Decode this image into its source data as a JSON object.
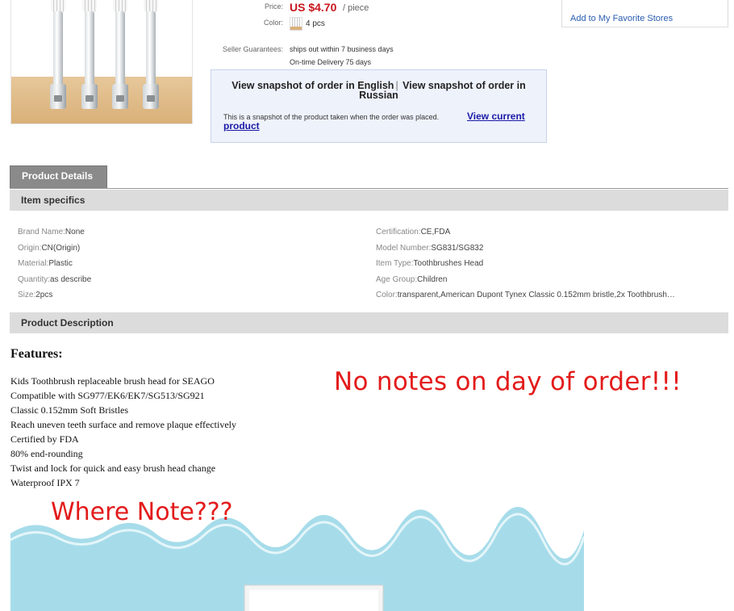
{
  "product": {
    "price_label": "Price:",
    "price_value": "US $4.70",
    "price_unit": "/ piece",
    "color_label": "Color:",
    "color_value": "4 pcs",
    "seller_label": "Seller Guarantees:",
    "guarantees": [
      "ships out within 7 business days",
      "On-time Delivery 75 days"
    ]
  },
  "store": {
    "favorite_link": "Add to My Favorite Stores"
  },
  "snapshot": {
    "english_link": "View snapshot of order in English",
    "separator": "|",
    "russian_link": "View snapshot of order in Russian",
    "note": "This is a snapshot of the product taken when the order was placed.",
    "current_link": "View current product"
  },
  "tabs": {
    "product_details": "Product Details"
  },
  "sections": {
    "item_specifics": "Item specifics",
    "product_description": "Product Description"
  },
  "specifics": {
    "left": [
      {
        "label": "Brand Name:",
        "value": "None"
      },
      {
        "label": "Origin:",
        "value": "CN(Origin)"
      },
      {
        "label": "Material:",
        "value": "Plastic"
      },
      {
        "label": "Quantity:",
        "value": "as describe"
      },
      {
        "label": "Size:",
        "value": "2pcs"
      }
    ],
    "right": [
      {
        "label": "Certification:",
        "value": "CE,FDA"
      },
      {
        "label": "Model Number:",
        "value": "SG831/SG832"
      },
      {
        "label": "Item Type:",
        "value": "Toothbrushes Head"
      },
      {
        "label": "Age Group:",
        "value": "Children"
      },
      {
        "label": "Color:",
        "value": "transparent,American Dupont Tynex Classic 0.152mm bristle,2x Toothbrush…"
      }
    ]
  },
  "description": {
    "features_title": "Features:",
    "features": [
      "Kids Toothbrush replaceable brush head for SEAGO",
      "Compatible with SG977/EK6/EK7/SG513/SG921",
      "Classic 0.152mm Soft Bristles",
      "Reach uneven teeth surface and remove plaque effectively",
      "Certified by FDA",
      "80% end-rounding",
      "Twist and lock for quick and easy brush head change",
      "Waterproof IPX 7"
    ]
  },
  "annotations": {
    "no_notes": "No notes on day of order!!!",
    "where_note": "Where Note???"
  },
  "colors": {
    "price_red": "#c8161d",
    "annotation_red": "#e31b1b",
    "link_blue": "#1a1aa6",
    "banner_blue": "#a6dcea"
  }
}
